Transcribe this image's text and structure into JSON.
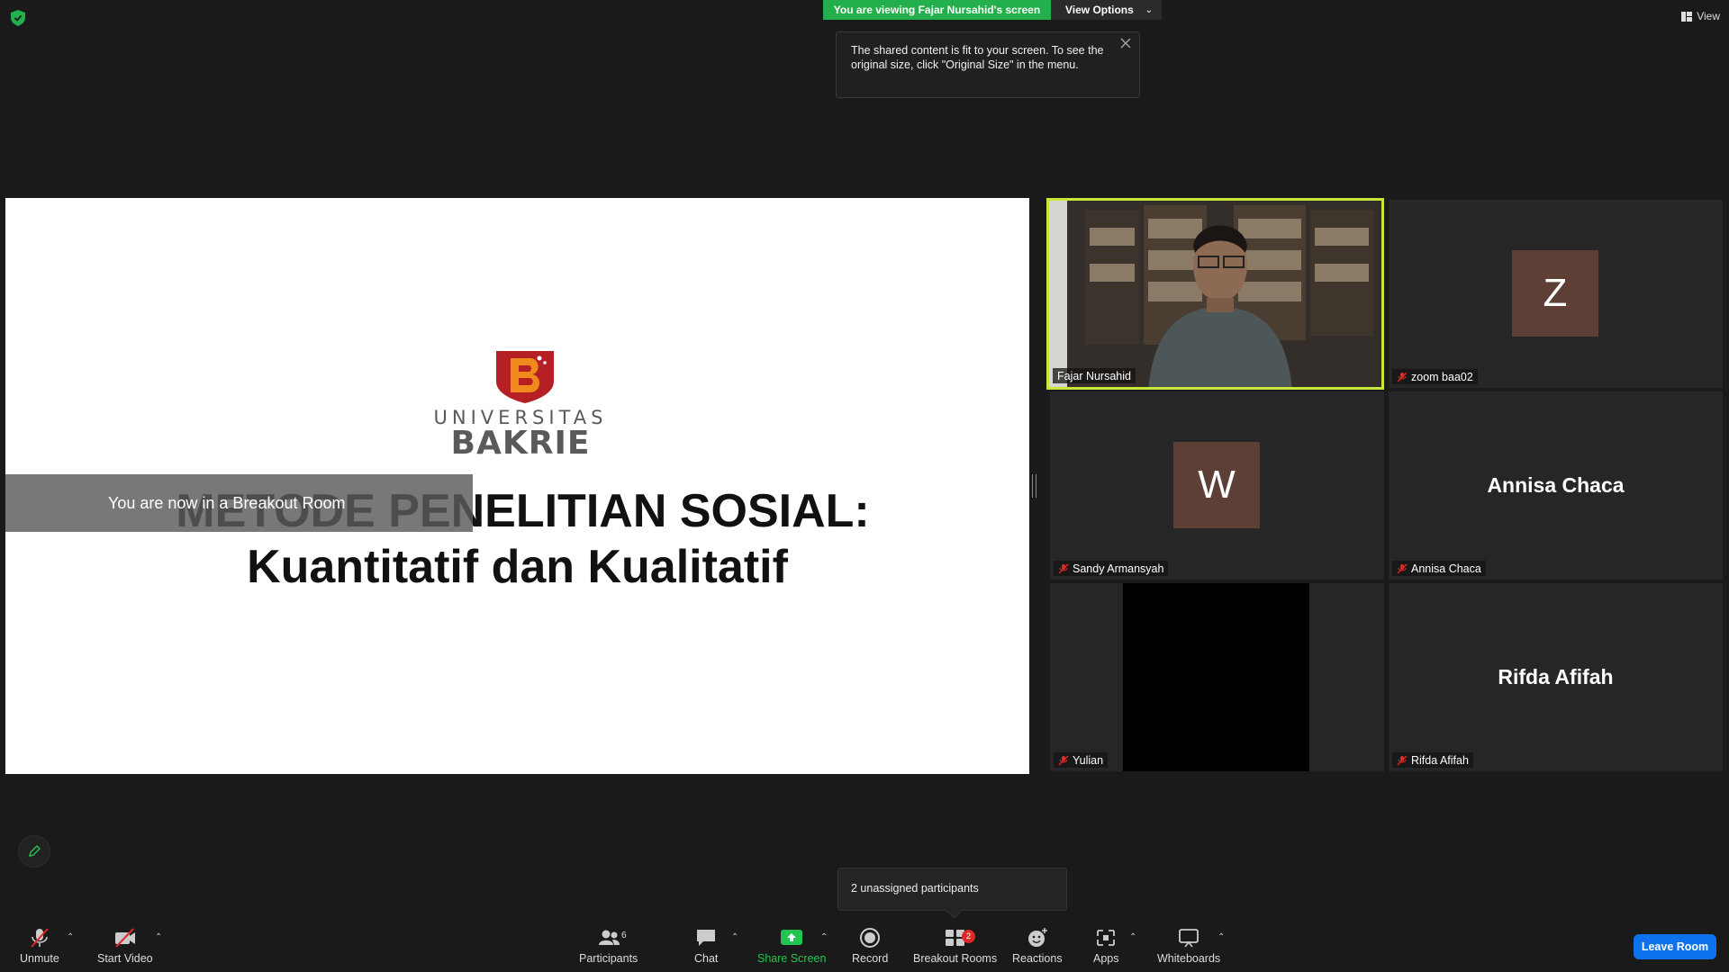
{
  "banner": {
    "viewing_text": "You are viewing Fajar Nursahid's screen",
    "view_options_label": "View Options"
  },
  "tooltip": {
    "text": "The shared content is fit to your screen. To see the original size, click \"Original Size\" in the menu."
  },
  "view_button": {
    "label": "View"
  },
  "slide": {
    "logo_line1": "UNIVERSITAS",
    "logo_line2": "BAKRIE",
    "title_line1": "METODE PENELITIAN SOSIAL:",
    "title_line2": "Kuantitatif dan Kualitatif"
  },
  "breakout_notice": "You are now in a Breakout Room",
  "participants_tiles": [
    {
      "name": "Fajar Nursahid",
      "type": "video",
      "muted": false,
      "active": true
    },
    {
      "name": "zoom baa02",
      "type": "avatar",
      "initial": "Z",
      "muted": true
    },
    {
      "name": "Sandy Armansyah",
      "type": "avatar",
      "initial": "W",
      "muted": true
    },
    {
      "name": "Annisa Chaca",
      "type": "name",
      "display": "Annisa Chaca",
      "muted": true
    },
    {
      "name": "Yulian",
      "type": "black",
      "muted": true
    },
    {
      "name": "Rifda Afifah",
      "type": "name",
      "display": "Rifda Afifah",
      "muted": true
    }
  ],
  "unassigned_popup": "2 unassigned participants",
  "toolbar": {
    "unmute": "Unmute",
    "start_video": "Start Video",
    "participants": "Participants",
    "participants_count": "6",
    "chat": "Chat",
    "share_screen": "Share Screen",
    "record": "Record",
    "breakout_rooms": "Breakout Rooms",
    "breakout_count": "2",
    "reactions": "Reactions",
    "apps": "Apps",
    "whiteboards": "Whiteboards",
    "leave": "Leave Room"
  },
  "colors": {
    "banner_green": "#23b04c",
    "active_border": "#c7e83a",
    "leave_blue": "#0e72ed",
    "avatar_brown": "#5d3f35",
    "logo_red": "#b52025",
    "logo_orange": "#f08a1c"
  }
}
